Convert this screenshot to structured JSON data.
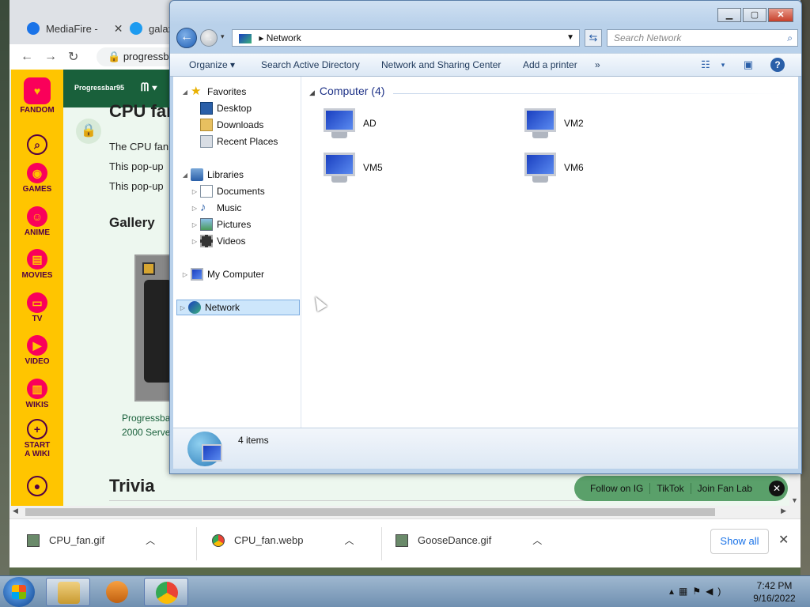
{
  "chrome": {
    "tabs": [
      {
        "label": "MediaFire -",
        "close": "✕"
      },
      {
        "label": "galax"
      }
    ],
    "address": "progressb",
    "nav_icons": [
      "back-icon",
      "forward-icon",
      "reload-icon",
      "lock-icon"
    ],
    "page": {
      "rail": [
        {
          "label": "FANDOM",
          "icon": "fandom-logo-icon"
        },
        {
          "label": "",
          "icon": "search-icon"
        },
        {
          "label": "GAMES",
          "icon": "gamepad-icon"
        },
        {
          "label": "ANIME",
          "icon": "anime-icon"
        },
        {
          "label": "MOVIES",
          "icon": "film-icon"
        },
        {
          "label": "TV",
          "icon": "tv-icon"
        },
        {
          "label": "VIDEO",
          "icon": "video-icon"
        },
        {
          "label": "WIKIS",
          "icon": "book-icon"
        },
        {
          "label": "START A WIKI",
          "icon": "plus-icon"
        },
        {
          "label": "",
          "icon": "user-icon"
        }
      ],
      "wiki_logo": "Progressbar95",
      "heading": "CPU fan",
      "lines": [
        "The CPU fan",
        "This pop-up",
        "This pop-up"
      ],
      "gallery": "Gallery",
      "caption_lines": [
        "Progressba",
        "2000 Serve"
      ],
      "trivia": "Trivia",
      "fan_bar": [
        "Follow on IG",
        "TikTok",
        "Join Fan Lab"
      ]
    },
    "downloads": [
      {
        "name": "CPU_fan.gif",
        "icon": "gif-file-icon"
      },
      {
        "name": "CPU_fan.webp",
        "icon": "chrome-file-icon"
      },
      {
        "name": "GooseDance.gif",
        "icon": "gif-file-icon"
      }
    ],
    "show_all": "Show all"
  },
  "explorer": {
    "breadcrumb": "Network",
    "search_placeholder": "Search Network",
    "toolbar": [
      "Organize",
      "Search Active Directory",
      "Network and Sharing Center",
      "Add a printer",
      "»"
    ],
    "nav": {
      "favorites": "Favorites",
      "favorites_items": [
        "Desktop",
        "Downloads",
        "Recent Places"
      ],
      "libraries": "Libraries",
      "libraries_items": [
        "Documents",
        "Music",
        "Pictures",
        "Videos"
      ],
      "my_computer": "My Computer",
      "network": "Network"
    },
    "group_header": "Computer (4)",
    "computers": [
      "AD",
      "VM2",
      "VM5",
      "VM6"
    ],
    "status": "4 items"
  },
  "taskbar": {
    "time": "7:42 PM",
    "date": "9/16/2022"
  },
  "colors": {
    "fandom_yellow": "#ffc500",
    "wiki_green": "#19603b",
    "explorer_blue": "#b9d1ea"
  }
}
